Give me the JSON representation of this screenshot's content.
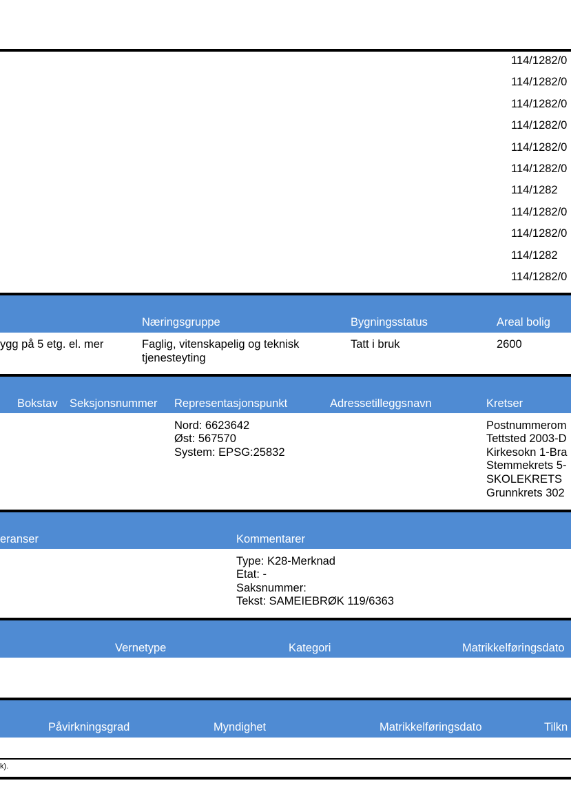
{
  "matrikkel_ids": [
    "114/1282/0",
    "114/1282/0",
    "114/1282/0",
    "114/1282/0",
    "114/1282/0",
    "114/1282/0",
    "114/1282",
    "114/1282/0",
    "114/1282/0",
    "114/1282",
    "114/1282/0"
  ],
  "building": {
    "headers": {
      "naeringsgruppe": "Næringsgruppe",
      "bygningsstatus": "Bygningsstatus",
      "areal_bolig": "Areal bolig"
    },
    "row": {
      "bygningstype": "ygg på 5 etg. el. mer",
      "naeringsgruppe_line1": "Faglig, vitenskapelig og teknisk",
      "naeringsgruppe_line2": "tjenesteyting",
      "bygningsstatus": "Tatt i bruk",
      "areal_bolig": "2600"
    }
  },
  "address": {
    "headers": {
      "bokstav": "Bokstav",
      "seksjonsnummer": "Seksjonsnummer",
      "representasjonspunkt": "Representasjonspunkt",
      "adressetilleggsnavn": "Adressetilleggsnavn",
      "kretser": "Kretser"
    },
    "representasjonspunkt": [
      "Nord: 6623642",
      "Øst: 567570",
      "System: EPSG:25832"
    ],
    "kretser": [
      "Postnummerom",
      "Tettsted 2003-D",
      "Kirkesokn 1-Bra",
      "Stemmekrets 5-",
      "SKOLEKRETS",
      "Grunnkrets 302"
    ]
  },
  "remarks": {
    "headers": {
      "referanser": "eranser",
      "kommentarer": "Kommentarer"
    },
    "kommentarer": [
      "Type: K28-Merknad",
      "Etat: -",
      "Saksnummer:",
      "Tekst: SAMEIEBRØK 119/6363"
    ]
  },
  "protection": {
    "headers": {
      "vernetype": "Vernetype",
      "kategori": "Kategori",
      "matrikkelforingsdato": "Matrikkelføringsdato"
    }
  },
  "impact": {
    "headers": {
      "pavirkningsgrad": "Påvirkningsgrad",
      "myndighet": "Myndighet",
      "matrikkelforingsdato": "Matrikkelføringsdato",
      "tilknytning": "Tilkn"
    }
  },
  "footnote": "k)."
}
